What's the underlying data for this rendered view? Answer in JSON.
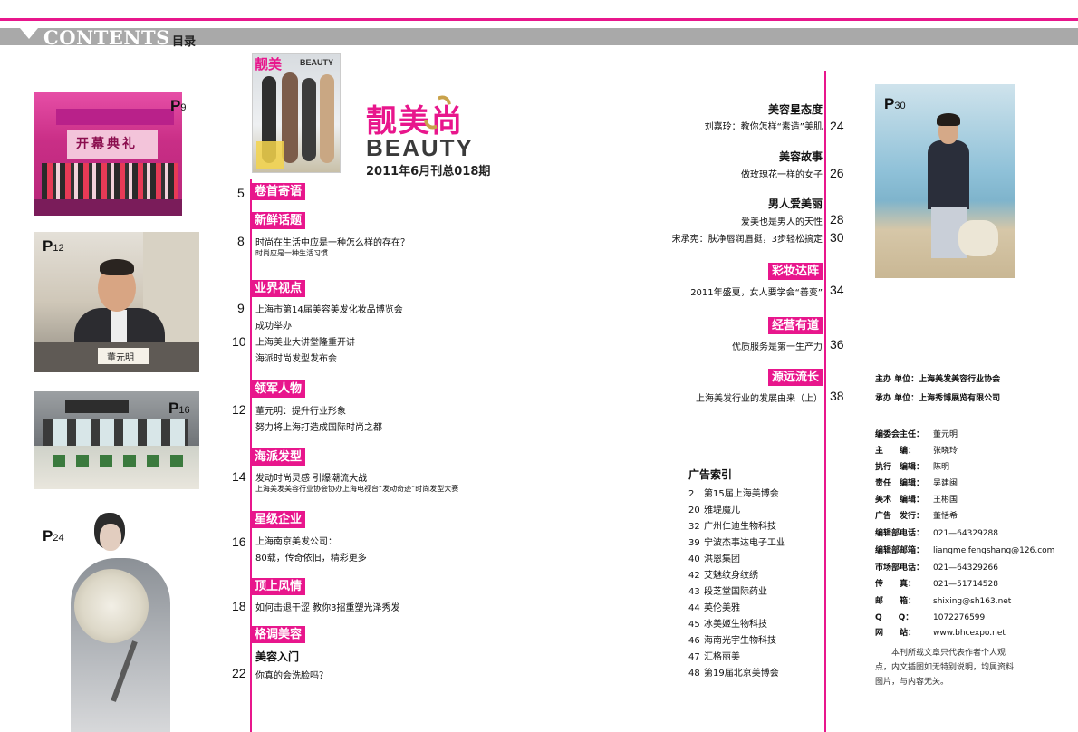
{
  "header": {
    "title": "CONTENTS",
    "subtitle": "目录"
  },
  "photos": {
    "p9": {
      "tag": "P",
      "num": "9",
      "sign": "开幕典礼"
    },
    "p12": {
      "tag": "P",
      "num": "12",
      "card": "董元明"
    },
    "p16": {
      "tag": "P",
      "num": "16"
    },
    "p24": {
      "tag": "P",
      "num": "24"
    },
    "p30": {
      "tag": "P",
      "num": "30"
    }
  },
  "cover": {
    "title_cn": "靓美",
    "title_en": "BEAUTY"
  },
  "logo": {
    "cn": "靓美尚",
    "en": "BEAUTY",
    "issue": "2011年6月刊总018期"
  },
  "left_sections": [
    {
      "num": "5",
      "title": "卷首寄语",
      "items": []
    },
    {
      "num": "8",
      "title": "新鲜话题",
      "items": [
        "时尚在生活中应是一种怎么样的存在？"
      ],
      "small": [
        "时尚应是一种生活习惯"
      ]
    },
    {
      "num": "9",
      "title": "业界视点",
      "items": [
        "上海市第14届美容美发化妆品博览会",
        "成功举办"
      ],
      "num2": "10",
      "items2": [
        "上海美业大讲堂隆重开讲",
        "海派时尚发型发布会"
      ]
    },
    {
      "num": "12",
      "title": "领军人物",
      "items": [
        "董元明：提升行业形象",
        "努力将上海打造成国际时尚之都"
      ]
    },
    {
      "num": "14",
      "title": "海派发型",
      "items": [
        "发动时尚灵感 引爆潮流大战"
      ],
      "small": [
        "上海美发美容行业协会协办上海电视台“发动奇迹”时尚发型大赛"
      ]
    },
    {
      "num": "16",
      "title": "星级企业",
      "items": [
        "上海南京美发公司：",
        "80载，传奇依旧，精彩更多"
      ]
    },
    {
      "num": "18",
      "title": "顶上风情",
      "items": [
        "如何击退干涩 教你3招重塑光泽秀发"
      ]
    },
    {
      "num": "22",
      "title": "格调美容",
      "sub": "美容入门",
      "items": [
        "你真的会洗脸吗？"
      ]
    }
  ],
  "right_sections": [
    {
      "title": "美容星态度",
      "items": [
        {
          "text": "刘嘉玲：教你怎样“素造”美肌",
          "num": "24"
        }
      ]
    },
    {
      "title": "美容故事",
      "items": [
        {
          "text": "做玫瑰花一样的女子",
          "num": "26"
        }
      ]
    },
    {
      "title": "男人爱美丽",
      "items": [
        {
          "text": "爱美也是男人的天性",
          "num": "28"
        },
        {
          "text": "宋承宪：肤净唇润眉挺，3步轻松搞定",
          "num": "30"
        }
      ]
    },
    {
      "title": "彩妆达阵",
      "items": [
        {
          "text": "2011年盛夏，女人要学会“善变”",
          "num": "34"
        }
      ]
    },
    {
      "title": "经营有道",
      "items": [
        {
          "text": "优质服务是第一生产力",
          "num": "36"
        }
      ]
    },
    {
      "title": "源远流长",
      "items": [
        {
          "text": "上海美发行业的发展由来（上）",
          "num": "38"
        }
      ]
    }
  ],
  "ad_index": {
    "title": "广告索引",
    "items": [
      {
        "page": "2",
        "name": "第15届上海美博会"
      },
      {
        "page": "20",
        "name": "雅堤魔儿"
      },
      {
        "page": "32",
        "name": "广州仁迪生物科技"
      },
      {
        "page": "39",
        "name": "宁波杰事达电子工业"
      },
      {
        "page": "40",
        "name": "洪恩集团"
      },
      {
        "page": "42",
        "name": "艾魅纹身纹绣"
      },
      {
        "page": "43",
        "name": "段芝堂国际药业"
      },
      {
        "page": "44",
        "name": "英伦美雅"
      },
      {
        "page": "45",
        "name": "冰美姬生物科技"
      },
      {
        "page": "46",
        "name": "海南光宇生物科技"
      },
      {
        "page": "47",
        "name": "汇格丽美"
      },
      {
        "page": "48",
        "name": "第19届北京美博会"
      }
    ]
  },
  "masthead": {
    "sponsor": "主办 单位：上海美发美容行业协会",
    "organizer": "承办 单位：上海秀博展览有限公司",
    "rows": [
      {
        "k": "编委会主任：",
        "v": "董元明"
      },
      {
        "k": "主　　编：",
        "v": "张晓玲"
      },
      {
        "k": "执行　编辑：",
        "v": "陈明"
      },
      {
        "k": "责任　编辑：",
        "v": "吴建闽"
      },
      {
        "k": "美术　编辑：",
        "v": "王彬国"
      },
      {
        "k": "广告　发行：",
        "v": "董恬希"
      },
      {
        "k": "编辑部电话：",
        "v": "021—64329288"
      },
      {
        "k": "编辑部邮箱：",
        "v": "liangmeifengshang@126.com"
      },
      {
        "k": "市场部电话：",
        "v": "021—64329266"
      },
      {
        "k": "传　　真：",
        "v": "021—51714528"
      },
      {
        "k": "邮　　箱：",
        "v": "shixing@sh163.net"
      },
      {
        "k": "Q　　Q：",
        "v": "1072276599"
      },
      {
        "k": "网　　站：",
        "v": "www.bhcexpo.net"
      }
    ],
    "note": "本刊所载文章只代表作者个人观点，内文插图如无特别说明，均属资料图片，与内容无关。"
  },
  "colors": {
    "accent": "#e8168c",
    "header_bar": "#a9a9a9"
  }
}
